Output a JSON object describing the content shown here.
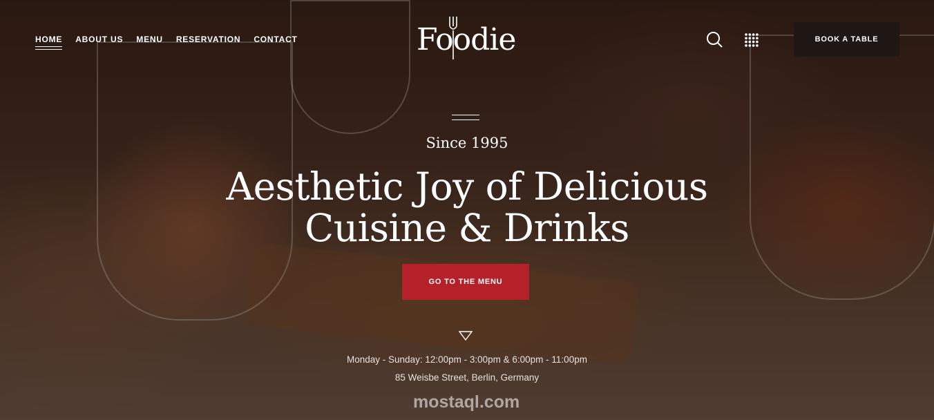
{
  "nav": {
    "items": [
      {
        "label": "HOME",
        "active": true
      },
      {
        "label": "ABOUT US"
      },
      {
        "label": "MENU"
      },
      {
        "label": "RESERVATION"
      },
      {
        "label": "CONTACT"
      }
    ]
  },
  "brand": {
    "logo_text": "Foodie"
  },
  "header": {
    "book_label": "BOOK A TABLE"
  },
  "hero": {
    "since": "Since 1995",
    "headline_line1": "Aesthetic Joy of Delicious",
    "headline_line2": "Cuisine & Drinks",
    "cta_label": "GO TO THE MENU",
    "hours": "Monday - Sunday: 12:00pm - 3:00pm & 6:00pm - 11:00pm",
    "address": "85 Weisbe Street, Berlin, Germany"
  },
  "watermark": "mostaql.com",
  "icons": [
    "search-icon",
    "grid-menu-icon",
    "fork-icon",
    "scroll-down-triangle-icon"
  ],
  "colors": {
    "accent_red": "#b52129",
    "book_button_bg": "#1f1713",
    "text": "#ffffff"
  }
}
